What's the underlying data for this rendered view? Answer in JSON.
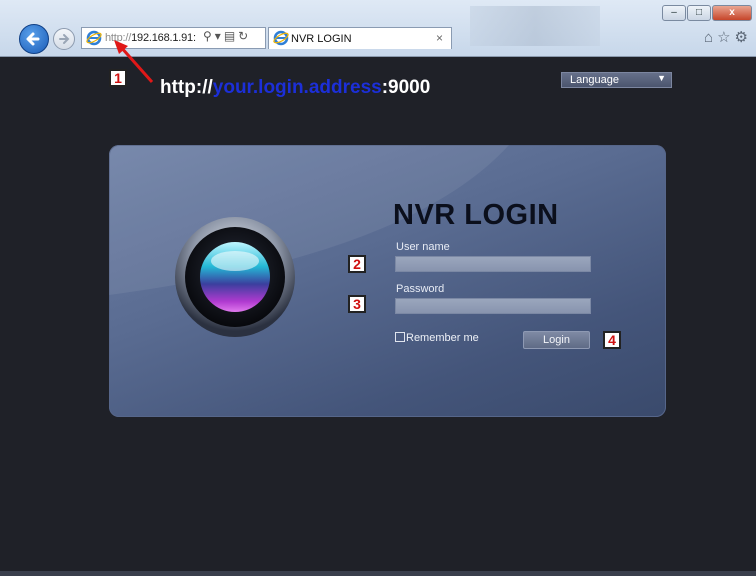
{
  "browser": {
    "address_prefix": "http://",
    "address_rest": "192.168.1.91:",
    "tab_title": "NVR LOGIN",
    "tab_close": "×",
    "window_buttons": {
      "minimize": "–",
      "maximize": "□",
      "close": "x"
    }
  },
  "hint": {
    "prefix": "http://",
    "placeholder": "your.login.address",
    "suffix": ":9000"
  },
  "language": {
    "label": "Language"
  },
  "login": {
    "title": "NVR LOGIN",
    "username_label": "User name",
    "password_label": "Password",
    "remember_label": "Remember me",
    "login_button": "Login"
  },
  "steps": [
    "1",
    "2",
    "3",
    "4"
  ],
  "colors": {
    "panel": "#5a6c92",
    "badge_text": "#d01010",
    "hint_highlight": "#1c2fd8",
    "background": "#1f2128"
  },
  "icons": [
    "back-arrow-icon",
    "forward-arrow-icon",
    "ie-logo-icon",
    "search-icon",
    "refresh-icon",
    "home-icon",
    "favorites-star-icon",
    "settings-gear-icon",
    "camera-lens-icon"
  ]
}
